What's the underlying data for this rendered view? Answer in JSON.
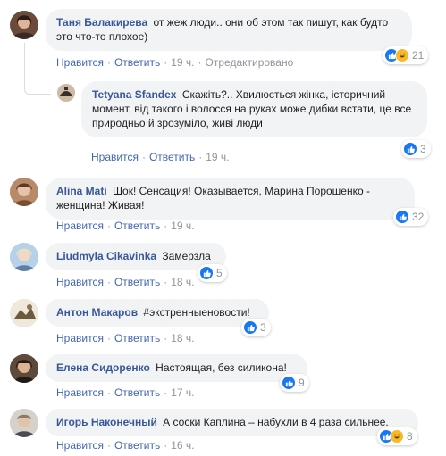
{
  "labels": {
    "like": "Нравится",
    "reply": "Ответить"
  },
  "reaction_colors": {
    "like": "#1877f2",
    "haha": "#f7b928"
  },
  "comments": [
    {
      "author": "Таня Балакирева",
      "text": "от жеж люди.. они об этом так пишут, как будто это что-то плохое)",
      "time": "19 ч.",
      "edited": "Отредактировано",
      "reactions": [
        "like-icon",
        "haha-icon"
      ],
      "count": "21"
    },
    {
      "author": "Tetyana Sfandex",
      "text": "Скажіть?.. Хвилюється жінка, історичний момент, від такого і волосся на руках може дибки встати, це все природньо й зрозуміло, живі люди",
      "time": "19 ч.",
      "reactions": [
        "like-icon"
      ],
      "count": "3"
    },
    {
      "author": "Alina Mati",
      "text": "Шок! Сенсация! Оказывается, Марина Порошенко - женщина! Живая!",
      "time": "19 ч.",
      "reactions": [
        "like-icon"
      ],
      "count": "32"
    },
    {
      "author": "Liudmyla Cikavinka",
      "text": "Замерзла",
      "time": "18 ч.",
      "reactions": [
        "like-icon"
      ],
      "count": "5"
    },
    {
      "author": "Антон Макаров",
      "text": "#экстренныеновости!",
      "time": "18 ч.",
      "reactions": [
        "like-icon"
      ],
      "count": "3"
    },
    {
      "author": "Елена Сидоренко",
      "text": "Настоящая, без силикона!",
      "time": "17 ч.",
      "reactions": [
        "like-icon"
      ],
      "count": "9"
    },
    {
      "author": "Игорь Наконечный",
      "text": "А соски Каплина – набухли в 4 раза сильнее.",
      "time": "16 ч.",
      "reactions": [
        "like-icon",
        "haha-icon"
      ],
      "count": "8"
    }
  ]
}
